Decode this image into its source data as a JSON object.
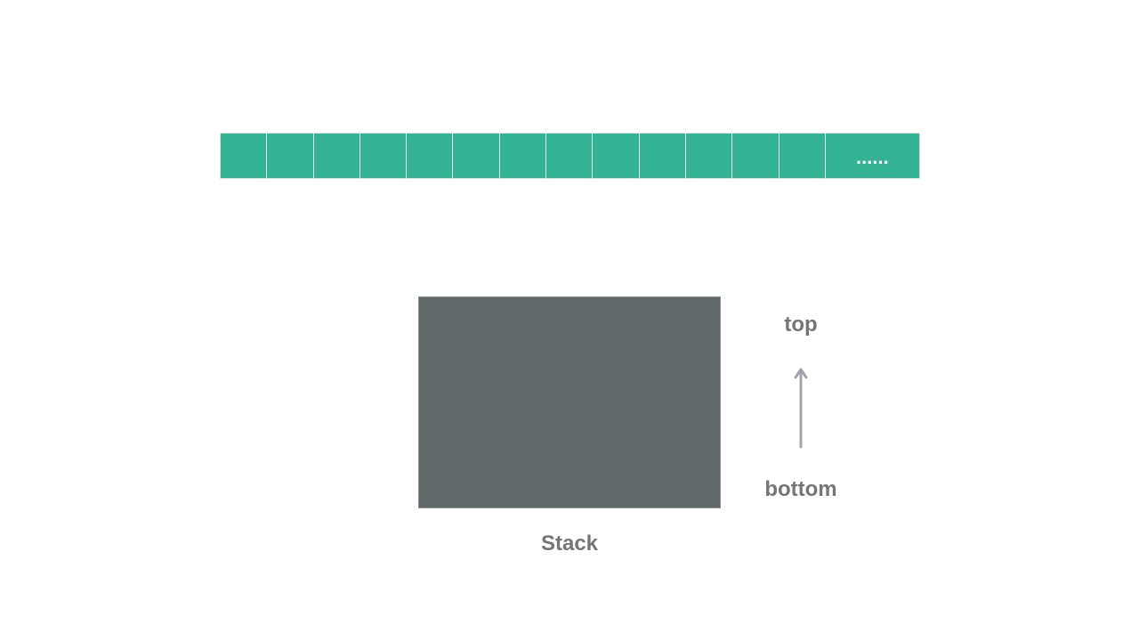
{
  "colors": {
    "cell": "#33b294",
    "stack": "#606869",
    "label": "#757575",
    "arrow": "#a3a3b0"
  },
  "array": {
    "filled_cells": 13,
    "continuation_label": "......"
  },
  "stack": {
    "caption": "Stack",
    "top_label": "top",
    "bottom_label": "bottom",
    "direction_icon": "arrow-up-icon"
  }
}
